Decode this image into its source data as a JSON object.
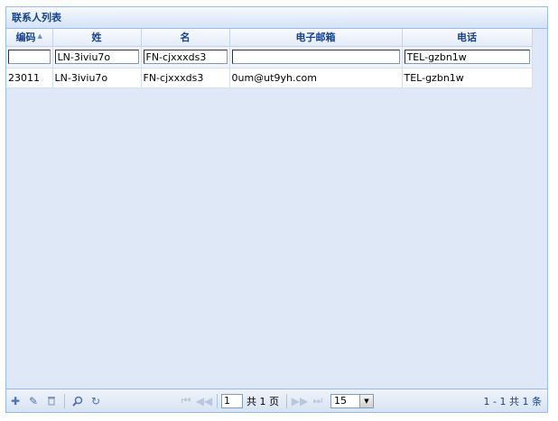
{
  "panel": {
    "title": "联系人列表"
  },
  "columns": [
    {
      "key": "id",
      "label": "编码",
      "sorted": true
    },
    {
      "key": "last",
      "label": "姓"
    },
    {
      "key": "first",
      "label": "名"
    },
    {
      "key": "email",
      "label": "电子邮箱"
    },
    {
      "key": "phone",
      "label": "电话"
    }
  ],
  "filters": {
    "id": "",
    "last": "LN-3iviu7o",
    "first": "FN-cjxxxds3",
    "email": "",
    "phone": "TEL-gzbn1w"
  },
  "rows": [
    {
      "id": "23011",
      "last": "LN-3iviu7o",
      "first": "FN-cjxxxds3",
      "email": "0um@ut9yh.com",
      "phone": "TEL-gzbn1w"
    }
  ],
  "pager": {
    "page": "1",
    "of_pages_label": "共 1 页",
    "page_size": "15",
    "summary": "1 - 1  共 1 条"
  },
  "icons": {
    "add": "plus-icon",
    "edit": "pencil-icon",
    "delete": "trash-icon",
    "search": "magnifier-icon",
    "refresh": "refresh-icon"
  }
}
